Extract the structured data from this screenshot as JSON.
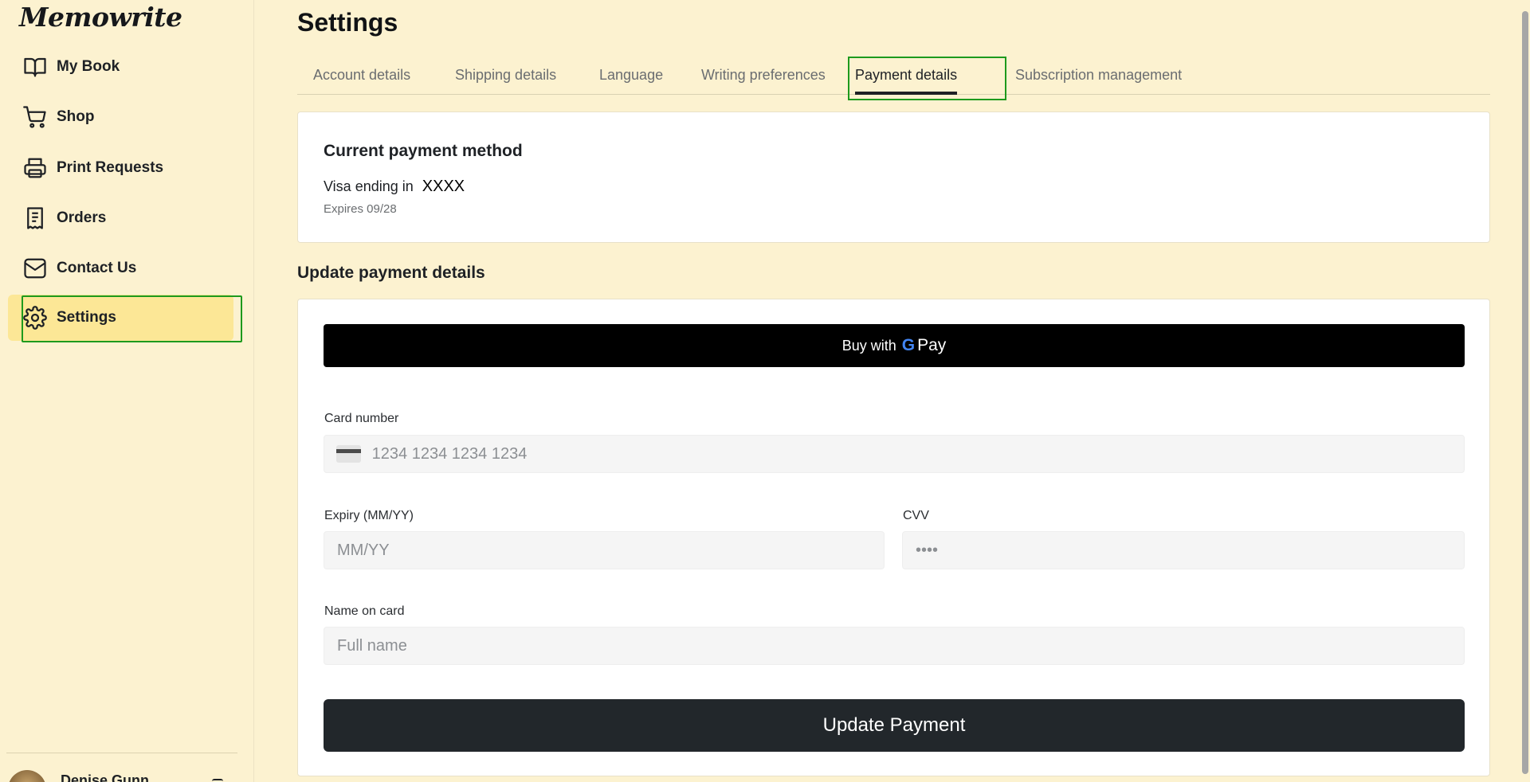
{
  "app": {
    "name": "Memowrite"
  },
  "sidebar": {
    "items": [
      {
        "label": "My Book",
        "icon": "book-open-icon"
      },
      {
        "label": "Shop",
        "icon": "shopping-cart-icon"
      },
      {
        "label": "Print Requests",
        "icon": "printer-icon"
      },
      {
        "label": "Orders",
        "icon": "receipt-icon"
      },
      {
        "label": "Contact Us",
        "icon": "mail-icon"
      },
      {
        "label": "Settings",
        "icon": "gear-icon",
        "active": true
      }
    ],
    "user": {
      "name": "Denise Gunn"
    }
  },
  "main": {
    "title": "Settings",
    "tabs": [
      {
        "label": "Account details"
      },
      {
        "label": "Shipping details"
      },
      {
        "label": "Language"
      },
      {
        "label": "Writing preferences"
      },
      {
        "label": "Payment details",
        "active": true
      },
      {
        "label": "Subscription management"
      }
    ],
    "current_payment": {
      "heading": "Current payment method",
      "card_text": "Visa ending in",
      "card_mask": "XXXX",
      "expires": "Expires 09/28"
    },
    "update": {
      "heading": "Update payment details",
      "gpay": {
        "prefix": "Buy with",
        "g": "G",
        "pay": "Pay"
      },
      "card_number": {
        "label": "Card number",
        "placeholder": "1234 1234 1234 1234"
      },
      "expiry": {
        "label": "Expiry (MM/YY)",
        "placeholder": "MM/YY"
      },
      "cvv": {
        "label": "CVV",
        "placeholder": "••••"
      },
      "name": {
        "label": "Name on card",
        "placeholder": "Full name"
      },
      "submit_label": "Update Payment"
    }
  },
  "colors": {
    "background": "#fcf2d0",
    "active_nav": "#fce796",
    "highlight_border": "#1d9a1d",
    "primary_button": "#22272b"
  }
}
